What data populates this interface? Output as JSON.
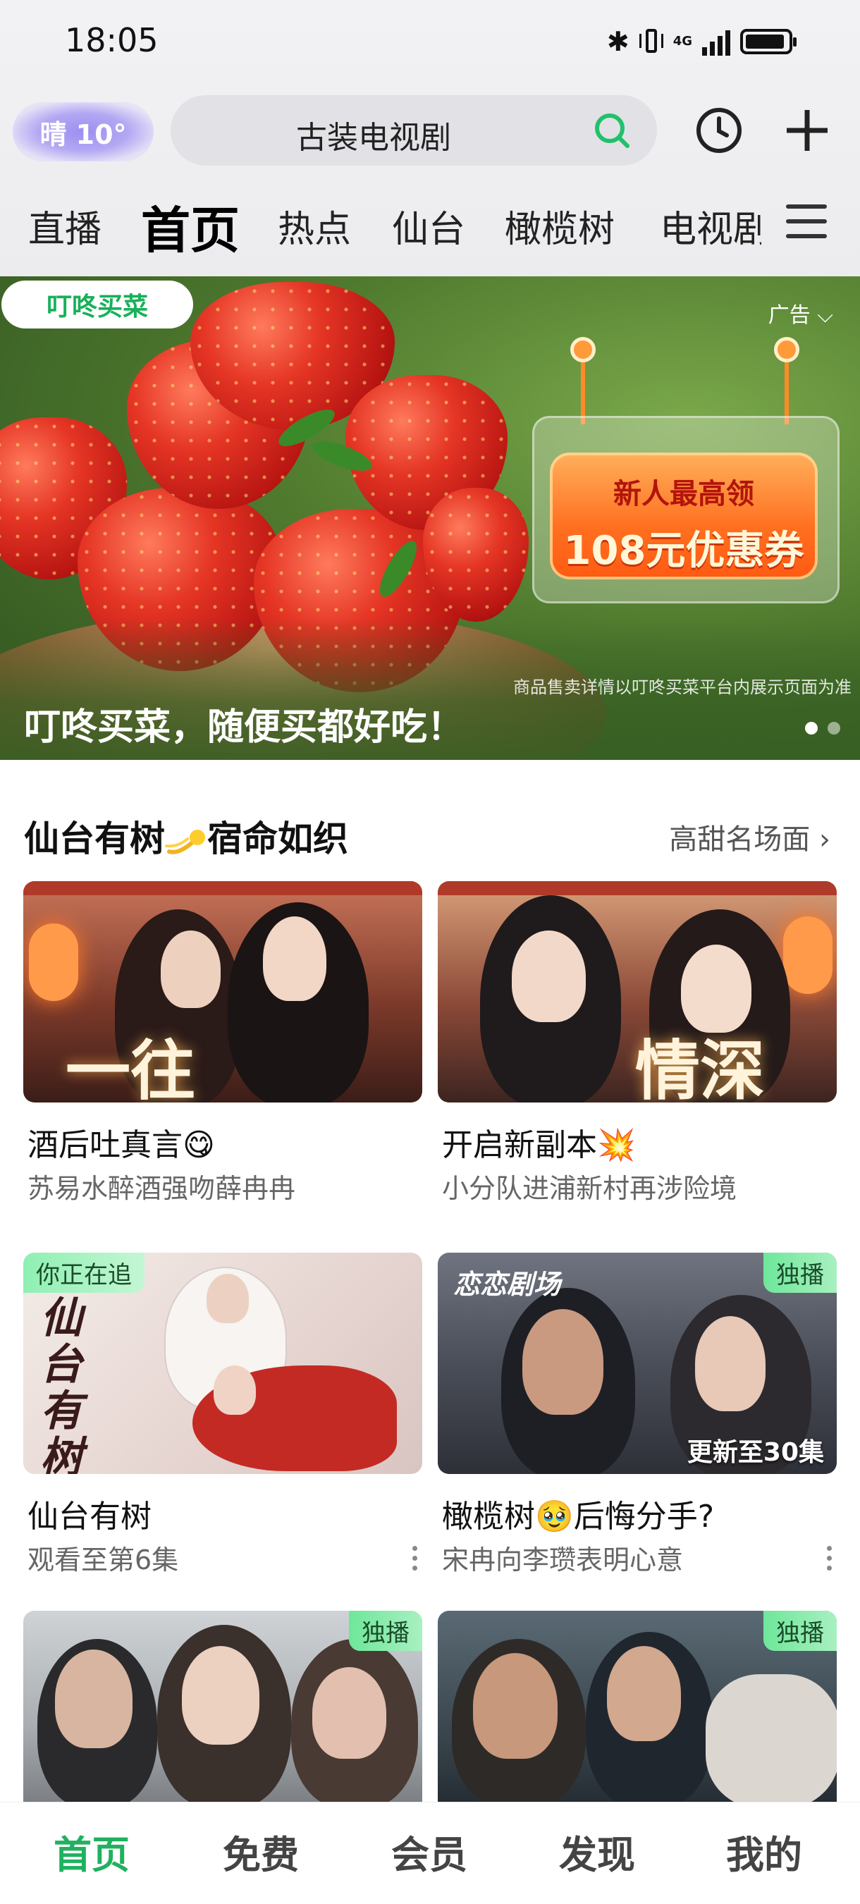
{
  "status_bar": {
    "time": "18:05",
    "network": "4G"
  },
  "header": {
    "weather": "晴 10°",
    "search_text": "古装电视剧"
  },
  "tabs": [
    "直播",
    "首页",
    "热点",
    "仙台",
    "橄榄树",
    "电视剧"
  ],
  "active_tab": "首页",
  "banner": {
    "brand": "叮咚买菜",
    "ad_label": "广告",
    "coupon_line1": "新人最高领",
    "coupon_line2": "108元优惠券",
    "disclaimer": "商品售卖详情以叮咚买菜平台内展示页面为准",
    "caption": "叮咚买菜，随便买都好吃！",
    "slides": 2,
    "active_slide": 1
  },
  "section": {
    "title_part1": "仙台有树",
    "title_part2": "宿命如织",
    "more": "高甜名场面"
  },
  "cards": [
    {
      "title": "酒后吐真言😋",
      "subtitle": "苏易水醉酒强吻薛冉冉",
      "overlay": "一往"
    },
    {
      "title": "开启新副本💥",
      "subtitle": "小分队进浦新村再涉险境",
      "overlay": "情深"
    },
    {
      "title": "仙台有树",
      "subtitle": "观看至第6集",
      "tag": "你正在追",
      "poster_text": "仙台有树"
    },
    {
      "title": "橄榄树🥹后悔分手?",
      "subtitle": "宋冉向李瓒表明心意",
      "tag": "独播",
      "logo": "恋恋剧场",
      "episode": "更新至30集"
    },
    {
      "tag": "独播"
    },
    {
      "tag": "独播"
    }
  ],
  "bottom_nav": [
    "首页",
    "免费",
    "会员",
    "发现",
    "我的"
  ],
  "colors": {
    "accent": "#20b15f",
    "tag_green": "#7ee9a6"
  }
}
